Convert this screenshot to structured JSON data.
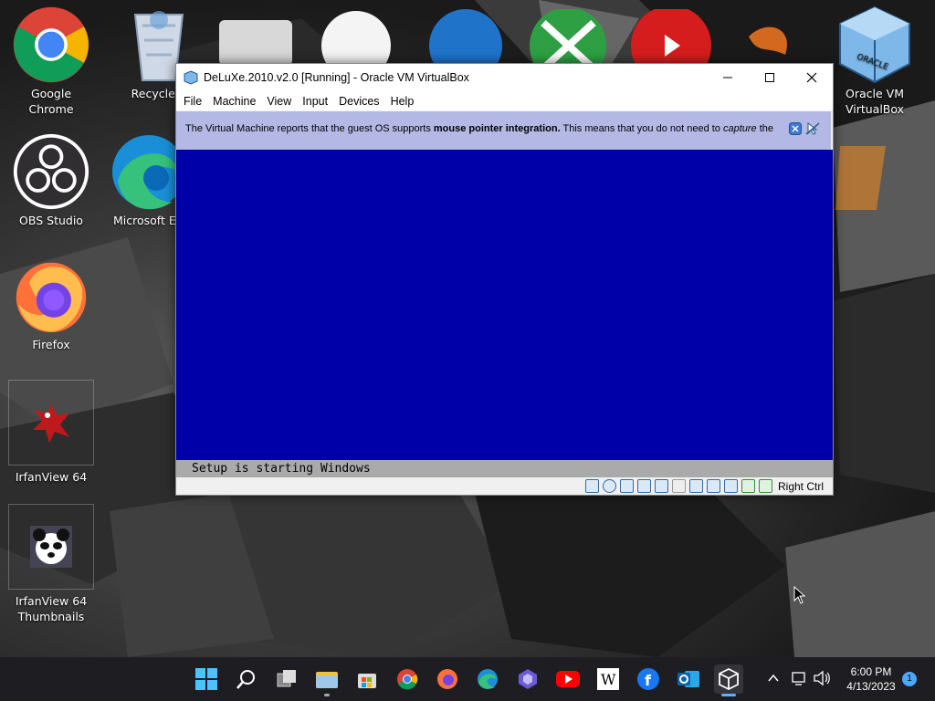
{
  "desktop": {
    "icons": [
      {
        "label": "Google Chrome"
      },
      {
        "label": "Recycle B"
      },
      {
        "label": "OBS Studio"
      },
      {
        "label": "Microsoft E"
      },
      {
        "label": "Firefox"
      },
      {
        "label": "IrfanView 64"
      },
      {
        "label": "IrfanView 64 Thumbnails"
      },
      {
        "label": "Oracle VM VirtualBox"
      }
    ]
  },
  "window": {
    "title": "DeLuXe.2010.v2.0 [Running] - Oracle VM VirtualBox",
    "menu": [
      "File",
      "Machine",
      "View",
      "Input",
      "Devices",
      "Help"
    ],
    "notice": {
      "part1": "The Virtual Machine reports that the guest OS supports ",
      "bold": "mouse pointer integration.",
      "part2": " This means that you do not need to ",
      "italic": "capture",
      "part3": " the"
    },
    "setup_text": "Setup is starting Windows",
    "host_key": "Right Ctrl",
    "status_icons": [
      "hard-disk-icon",
      "optical-drive-icon",
      "audio-icon",
      "network-icon",
      "usb-icon",
      "shared-folders-icon",
      "display-icon",
      "recording-icon",
      "cpu-icon",
      "mouse-integration-icon",
      "keyboard-capture-icon"
    ]
  },
  "taskbar": {
    "apps": [
      "start-icon",
      "search-icon",
      "task-view-icon",
      "file-explorer-icon",
      "microsoft-store-icon",
      "chrome-icon",
      "firefox-icon",
      "edge-icon",
      "clipchamp-icon",
      "youtube-icon",
      "wikipedia-icon",
      "facebook-icon",
      "outlook-icon",
      "virtualbox-icon"
    ],
    "time": "6:00 PM",
    "date": "4/13/2023",
    "notifications": "1"
  },
  "colors": {
    "vm_screen": "#0000a8",
    "setup_bar": "#aaaaaa",
    "notice_bg": "#b4b8e4",
    "taskbar": "#1e1e22"
  }
}
